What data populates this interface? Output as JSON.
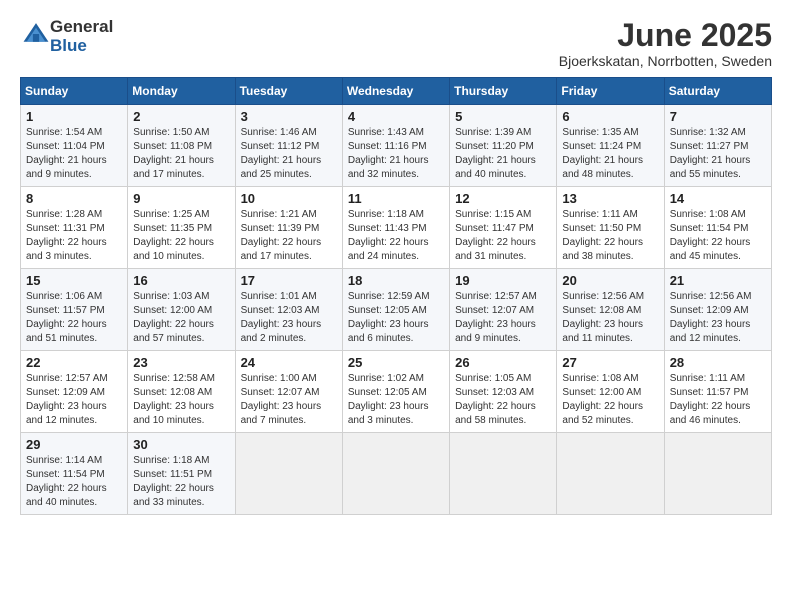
{
  "header": {
    "logo_general": "General",
    "logo_blue": "Blue",
    "month_title": "June 2025",
    "location": "Bjoerkskatan, Norrbotten, Sweden"
  },
  "days_of_week": [
    "Sunday",
    "Monday",
    "Tuesday",
    "Wednesday",
    "Thursday",
    "Friday",
    "Saturday"
  ],
  "weeks": [
    [
      {
        "day": "1",
        "sunrise": "1:54 AM",
        "sunset": "11:04 PM",
        "daylight": "21 hours and 9 minutes."
      },
      {
        "day": "2",
        "sunrise": "1:50 AM",
        "sunset": "11:08 PM",
        "daylight": "21 hours and 17 minutes."
      },
      {
        "day": "3",
        "sunrise": "1:46 AM",
        "sunset": "11:12 PM",
        "daylight": "21 hours and 25 minutes."
      },
      {
        "day": "4",
        "sunrise": "1:43 AM",
        "sunset": "11:16 PM",
        "daylight": "21 hours and 32 minutes."
      },
      {
        "day": "5",
        "sunrise": "1:39 AM",
        "sunset": "11:20 PM",
        "daylight": "21 hours and 40 minutes."
      },
      {
        "day": "6",
        "sunrise": "1:35 AM",
        "sunset": "11:24 PM",
        "daylight": "21 hours and 48 minutes."
      },
      {
        "day": "7",
        "sunrise": "1:32 AM",
        "sunset": "11:27 PM",
        "daylight": "21 hours and 55 minutes."
      }
    ],
    [
      {
        "day": "8",
        "sunrise": "1:28 AM",
        "sunset": "11:31 PM",
        "daylight": "22 hours and 3 minutes."
      },
      {
        "day": "9",
        "sunrise": "1:25 AM",
        "sunset": "11:35 PM",
        "daylight": "22 hours and 10 minutes."
      },
      {
        "day": "10",
        "sunrise": "1:21 AM",
        "sunset": "11:39 PM",
        "daylight": "22 hours and 17 minutes."
      },
      {
        "day": "11",
        "sunrise": "1:18 AM",
        "sunset": "11:43 PM",
        "daylight": "22 hours and 24 minutes."
      },
      {
        "day": "12",
        "sunrise": "1:15 AM",
        "sunset": "11:47 PM",
        "daylight": "22 hours and 31 minutes."
      },
      {
        "day": "13",
        "sunrise": "1:11 AM",
        "sunset": "11:50 PM",
        "daylight": "22 hours and 38 minutes."
      },
      {
        "day": "14",
        "sunrise": "1:08 AM",
        "sunset": "11:54 PM",
        "daylight": "22 hours and 45 minutes."
      }
    ],
    [
      {
        "day": "15",
        "sunrise": "1:06 AM",
        "sunset": "11:57 PM",
        "daylight": "22 hours and 51 minutes."
      },
      {
        "day": "16",
        "sunrise": "1:03 AM",
        "sunset": "12:00 AM",
        "daylight": "22 hours and 57 minutes."
      },
      {
        "day": "17",
        "sunrise": "1:01 AM",
        "sunset": "12:03 AM",
        "daylight": "23 hours and 2 minutes."
      },
      {
        "day": "18",
        "sunrise": "12:59 AM",
        "sunset": "12:05 AM",
        "daylight": "23 hours and 6 minutes."
      },
      {
        "day": "19",
        "sunrise": "12:57 AM",
        "sunset": "12:07 AM",
        "daylight": "23 hours and 9 minutes."
      },
      {
        "day": "20",
        "sunrise": "12:56 AM",
        "sunset": "12:08 AM",
        "daylight": "23 hours and 11 minutes."
      },
      {
        "day": "21",
        "sunrise": "12:56 AM",
        "sunset": "12:09 AM",
        "daylight": "23 hours and 12 minutes."
      }
    ],
    [
      {
        "day": "22",
        "sunrise": "12:57 AM",
        "sunset": "12:09 AM",
        "daylight": "23 hours and 12 minutes."
      },
      {
        "day": "23",
        "sunrise": "12:58 AM",
        "sunset": "12:08 AM",
        "daylight": "23 hours and 10 minutes."
      },
      {
        "day": "24",
        "sunrise": "1:00 AM",
        "sunset": "12:07 AM",
        "daylight": "23 hours and 7 minutes."
      },
      {
        "day": "25",
        "sunrise": "1:02 AM",
        "sunset": "12:05 AM",
        "daylight": "23 hours and 3 minutes."
      },
      {
        "day": "26",
        "sunrise": "1:05 AM",
        "sunset": "12:03 AM",
        "daylight": "22 hours and 58 minutes."
      },
      {
        "day": "27",
        "sunrise": "1:08 AM",
        "sunset": "12:00 AM",
        "daylight": "22 hours and 52 minutes."
      },
      {
        "day": "28",
        "sunrise": "1:11 AM",
        "sunset": "11:57 PM",
        "daylight": "22 hours and 46 minutes."
      }
    ],
    [
      {
        "day": "29",
        "sunrise": "1:14 AM",
        "sunset": "11:54 PM",
        "daylight": "22 hours and 40 minutes."
      },
      {
        "day": "30",
        "sunrise": "1:18 AM",
        "sunset": "11:51 PM",
        "daylight": "22 hours and 33 minutes."
      },
      null,
      null,
      null,
      null,
      null
    ]
  ],
  "labels": {
    "sunrise": "Sunrise:",
    "sunset": "Sunset:",
    "daylight": "Daylight:"
  }
}
